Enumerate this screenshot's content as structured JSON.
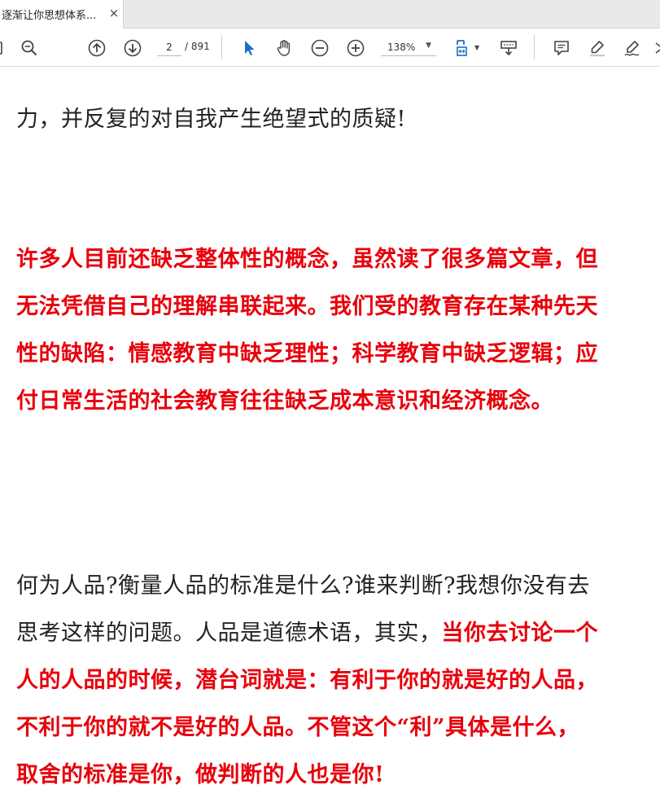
{
  "tab": {
    "title": "逐渐让你思想体系...",
    "close": "×"
  },
  "toolbar": {
    "page_current": "2",
    "page_total": "/ 891",
    "zoom": "138%",
    "icons": [
      "zoom-search-icon",
      "page-up-icon",
      "page-down-icon",
      "select-arrow-icon",
      "hand-icon",
      "zoom-out-icon",
      "zoom-in-icon",
      "fit-page-icon",
      "scroll-mode-icon",
      "comment-icon",
      "highlight-icon",
      "sign-icon"
    ]
  },
  "document": {
    "para1": "力，并反复的对自我产生绝望式的质疑!",
    "para2_lines": [
      "许多人目前还缺乏整体性的概念，虽然读了很多篇文章，但",
      "无法凭借自己的理解串联起来。我们受的教育存在某种先天",
      "性的缺陷：情感教育中缺乏理性；科学教育中缺乏逻辑；应",
      "付日常生活的社会教育往往缺乏成本意识和经济概念。"
    ],
    "para3": {
      "line1": "何为人品?衡量人品的标准是什么?谁来判断?我想你没有去",
      "line2_normal": "思考这样的问题。人品是道德术语，其实，",
      "line2_red": "当你去讨论一个",
      "line3": "人的人品的时候，潜台词就是：有利于你的就是好的人品，",
      "line4": "不利于你的就不是好的人品。不管这个“利”具体是什么，",
      "line5": "取舍的标准是你，做判断的人也是你!"
    }
  },
  "colors": {
    "emphasis_red": "#e8000b",
    "accent_blue": "#1a6fc9"
  }
}
